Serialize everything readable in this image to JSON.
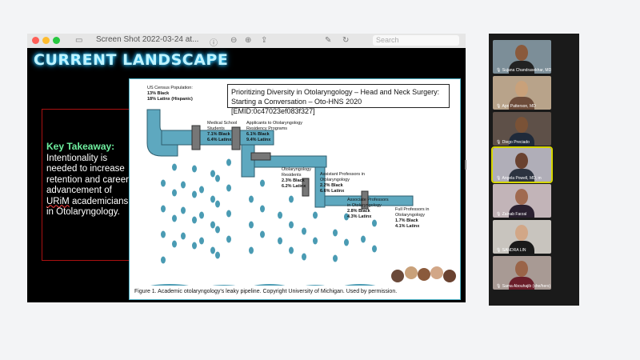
{
  "macbar": {
    "title": "Screen Shot 2022-03-24 at...",
    "search_placeholder": "Search",
    "colors": {
      "close": "#ff5f57",
      "min": "#febc2e",
      "max": "#28c840"
    }
  },
  "slide": {
    "title": "CURRENT LANDSCAPE",
    "takeaway_heading": "Key Takeaway",
    "takeaway_colon": ":",
    "takeaway_body_1": "Intentionality is needed to increase retention and career advancement of ",
    "takeaway_urim": "URiM",
    "takeaway_body_2": " academicians in Otolaryngology.",
    "reference": "Prioritizing Diversity in Otolaryngology – Head and Neck Surgery:  Starting a Conversation – Oto-HNS 2020 [EMID:0c47023ef083f327]",
    "caption": "Figure 1. Academic otolaryngology's leaky pipeline. Copyright University of Michigan. Used by permission.",
    "stages": [
      {
        "name": "US Census Population:",
        "black": "13% Black",
        "latinx": "18% Latinx (Hispanic)"
      },
      {
        "name": "Medical School Students",
        "black": "7.1% Black",
        "latinx": "6.4% Latinx"
      },
      {
        "name": "Applicants to Otolaryngology Residency Programs",
        "black": "6.1% Black",
        "latinx": "9.4% Latinx"
      },
      {
        "name": "Otolaryngology Residents",
        "black": "2.3% Black",
        "latinx": "6.2% Latinx"
      },
      {
        "name": "Assistant Professors in Otolaryngology",
        "black": "2.2% Black",
        "latinx": "6.6% Latinx"
      },
      {
        "name": "Associate Professors in Otolaryngology",
        "black": "2.8% Black",
        "latinx": "4.3% Latinx"
      },
      {
        "name": "Full Professors in Otolaryngology",
        "black": "1.7% Black",
        "latinx": "4.1% Latinx"
      }
    ]
  },
  "participants": [
    {
      "name": "Sujana Chandrasekhar, MD",
      "bg": "#7c8e98",
      "skin": "#8a5a3c",
      "shirt": "#222"
    },
    {
      "name": "Apri Patterson, MD",
      "bg": "#b8a38a",
      "skin": "#c9a17a",
      "shirt": "#6d4c3a"
    },
    {
      "name": "Diego Preciado",
      "bg": "#5e5048",
      "skin": "#7a5236",
      "shirt": "#1f2a3a"
    },
    {
      "name": "Angela Powell, MD, m",
      "bg": "#b0aeb8",
      "skin": "#6a4230",
      "shirt": "#2c3340",
      "active": true
    },
    {
      "name": "Zainab Farzal",
      "bg": "#c2b4b8",
      "skin": "#a06a50",
      "shirt": "#2a2030"
    },
    {
      "name": "SANDRA LIN",
      "bg": "#c8c4be",
      "skin": "#d2a787",
      "shirt": "#1a1a1a"
    },
    {
      "name": "Sama Abouhajib (she/hers)",
      "bg": "#a89a94",
      "skin": "#9a6448",
      "shirt": "#6a1e2a"
    }
  ]
}
